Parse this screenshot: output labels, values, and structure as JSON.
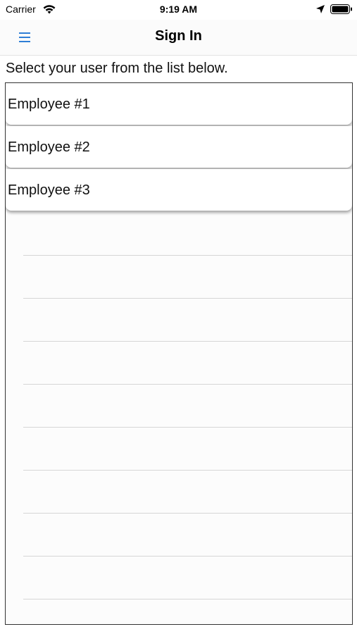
{
  "status_bar": {
    "carrier": "Carrier",
    "time": "9:19 AM",
    "icons": [
      "wifi-icon",
      "location-icon",
      "battery-icon"
    ]
  },
  "nav": {
    "title": "Sign In",
    "menu_icon": "hamburger-menu-icon",
    "accent_color": "#2f7fd6"
  },
  "instruction": "Select your user from the list below.",
  "employees": [
    {
      "label": "Employee #1"
    },
    {
      "label": "Employee #2"
    },
    {
      "label": "Employee #3"
    }
  ]
}
